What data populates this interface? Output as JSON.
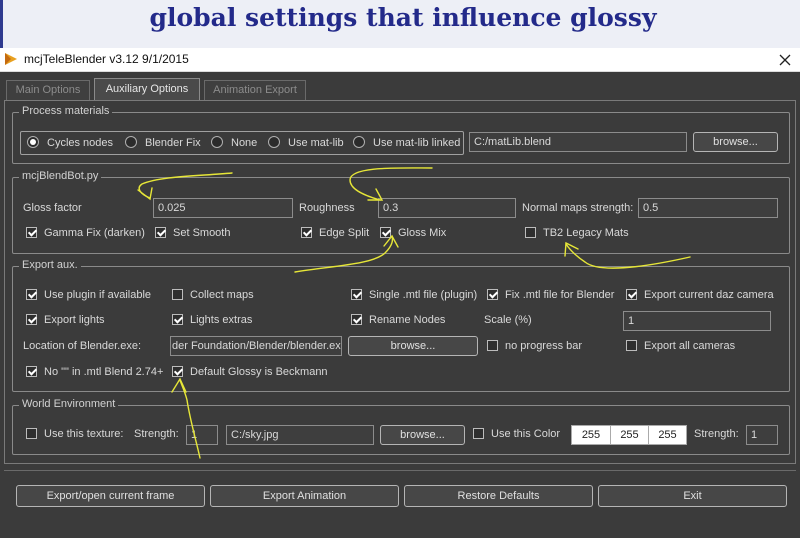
{
  "banner": {
    "title": "global settings that influence glossy"
  },
  "window": {
    "title": "mcjTeleBlender v3.12 9/1/2015"
  },
  "tabs": [
    {
      "label": "Main Options",
      "active": false
    },
    {
      "label": "Auxiliary Options",
      "active": true
    },
    {
      "label": "Animation Export",
      "active": false
    }
  ],
  "process_materials": {
    "legend": "Process materials",
    "options": [
      {
        "label": "Cycles nodes",
        "selected": true
      },
      {
        "label": "Blender Fix",
        "selected": false
      },
      {
        "label": "None",
        "selected": false
      },
      {
        "label": "Use mat-lib",
        "selected": false
      },
      {
        "label": "Use mat-lib linked",
        "selected": false
      }
    ],
    "matlib_path": "C:/matLib.blend",
    "browse_label": "browse..."
  },
  "blendbot": {
    "legend": "mcjBlendBot.py",
    "gloss_factor_label": "Gloss factor",
    "gloss_factor_value": "0.025",
    "roughness_label": "Roughness",
    "roughness_value": "0.3",
    "normal_label": "Normal maps strength:",
    "normal_value": "0.5",
    "checks": [
      {
        "label": "Gamma Fix (darken)",
        "checked": true
      },
      {
        "label": "Set Smooth",
        "checked": true
      },
      {
        "label": "Edge Split",
        "checked": true
      },
      {
        "label": "Gloss Mix",
        "checked": true
      },
      {
        "label": "TB2 Legacy Mats",
        "checked": false
      }
    ]
  },
  "export_aux": {
    "legend": "Export aux.",
    "checks": [
      {
        "label": "Use plugin if available",
        "checked": true
      },
      {
        "label": "Collect maps",
        "checked": false
      },
      {
        "label": "Single .mtl file (plugin)",
        "checked": true
      },
      {
        "label": "Fix .mtl file for Blender",
        "checked": true
      },
      {
        "label": "Export current daz camera",
        "checked": true
      },
      {
        "label": "Export lights",
        "checked": true
      },
      {
        "label": "Lights extras",
        "checked": true
      },
      {
        "label": "Rename Nodes",
        "checked": true
      },
      {
        "label": "no progress bar",
        "checked": false
      },
      {
        "label": "Export all cameras",
        "checked": false
      },
      {
        "label": "No \"\" in .mtl Blend 2.74+",
        "checked": true
      },
      {
        "label": "Default Glossy is Beckmann",
        "checked": true
      }
    ],
    "scale_label": "Scale (%)",
    "scale_value": "1",
    "location_label": "Location of Blender.exe:",
    "blender_path": "der Foundation/Blender/blender.exe",
    "browse_label": "browse..."
  },
  "world": {
    "legend": "World Environment",
    "use_texture_label": "Use this texture:",
    "use_texture_checked": false,
    "strength_label": "Strength:",
    "texture_strength": "1",
    "texture_path": "C:/sky.jpg",
    "browse_label": "browse...",
    "use_color_label": "Use this Color",
    "use_color_checked": false,
    "color": [
      "255",
      "255",
      "255"
    ],
    "color_strength_label": "Strength:",
    "color_strength": "1"
  },
  "footer": {
    "export_frame": "Export/open current frame",
    "export_animation": "Export Animation",
    "restore": "Restore Defaults",
    "exit": "Exit"
  },
  "colors": {
    "banner_text": "#232a8a",
    "window_bg": "#3b3b3b",
    "annotation": "#e6e638"
  }
}
